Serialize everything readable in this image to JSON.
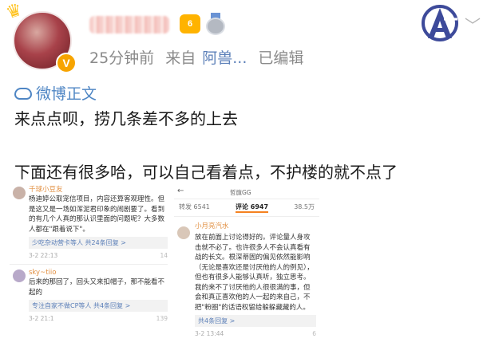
{
  "post": {
    "time": "25分钟前",
    "source_prefix": "来自",
    "source_name": "阿兽...",
    "edited": "已编辑",
    "level_badge": "6",
    "verified_badge": "V",
    "weibo_tag": "微博正文",
    "line1": "来点点呗，捞几条差不多的上去",
    "line2": "下面还有很多哈，可以自己看着点，不护楼的就不点了"
  },
  "thumb1": {
    "comments": [
      {
        "name": "千球小豆友",
        "text": "杨迪婷公取宠信项目，内容还算客观理性。但是这又是一场如浑泥君印象的闹剧要了。看到的有几个人真的那认识里面的问题呢？大多数人都在\"跟着说下\"。",
        "reply": "少吃杂动营卡等人  共24条回复 >",
        "foot_time": "3-2 22:13",
        "foot_count": "14"
      },
      {
        "name": "sky~tiio",
        "text": "后来的那回了，回头又来扣帽子，那不能看不起的",
        "reply": "专注自家不做CP等人  共4条回复 >",
        "foot_time": "3-2 21:1",
        "foot_count": "139"
      }
    ]
  },
  "thumb2": {
    "back": "←",
    "title": "哲旗GG",
    "tabs": [
      "转发 6541",
      "评论 6947",
      "38.5万"
    ],
    "name": "小月亮汽水",
    "text": "放在前面上讨论得好的。评论量人身攻击就不必了。也许很多人不会认真看有战的长文。根深蒂固的偏见依然能影响（无论是喜欢还是讨厌他的人的例见），但也有很多人能够认真听，独立思考。我的来不了讨厌他的人很很满的事，但会和真正喜欢他的人一起的来自己，不把\"粉圈\"的话语权留给躲躲藏藏的人。",
    "reply": "共4条回复 >",
    "foot_time": "3-2 13:44",
    "foot_count": "6"
  },
  "colors": {
    "accent_blue": "#4f86c4",
    "meta_gray": "#8a8a8a",
    "source_blue": "#5b7fb8",
    "badge_orange": "#f7a400"
  },
  "icons": [
    "crown-icon",
    "verified-v-icon",
    "level-badge-icon",
    "medal-icon",
    "avengers-logo-icon",
    "chevron-down-icon",
    "cloud-icon"
  ]
}
